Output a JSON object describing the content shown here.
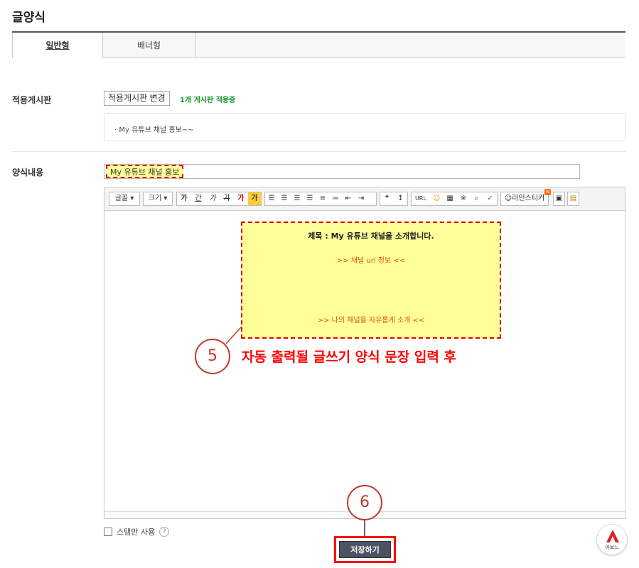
{
  "page_title": "글양식",
  "tabs": [
    {
      "label": "일반형",
      "active": true
    },
    {
      "label": "배너형",
      "active": false
    }
  ],
  "board": {
    "label": "적용게시판",
    "change_button": "적용게시판 변경",
    "status": "1개 게시판 적용중",
    "item": "· My 유튜브 채널 홍보~~"
  },
  "form": {
    "label": "양식내용",
    "title_value": "My 유튜브 채널 홍보"
  },
  "toolbar": {
    "font_label": "글꼴",
    "size_label": "크기",
    "style_buttons": [
      "가",
      "간",
      "가",
      "가",
      "가",
      "가"
    ],
    "url_label": "URL",
    "sticker_label": "라인스티커",
    "sticker_badge": "N"
  },
  "template": {
    "title": "제목 : My 유튜브 채널을 소개합니다.",
    "url_line": ">> 채널 url 정보 <<",
    "intro_line": ">> 나의 채널을 자유롭게 소개 <<"
  },
  "callouts": {
    "step5_number": "5",
    "step5_text": "자동 출력될 글쓰기 양식 문장 입력 후",
    "step6_number": "6"
  },
  "stamp_only": {
    "label": "스탬만 사용",
    "help": "?"
  },
  "save_button": "저장하기",
  "logo": {
    "text": "아보느"
  },
  "colors": {
    "highlight": "#ffff99",
    "annotation_red": "#ff0000",
    "status_green": "#1a9a2a",
    "save_button_bg": "#4b5363"
  }
}
